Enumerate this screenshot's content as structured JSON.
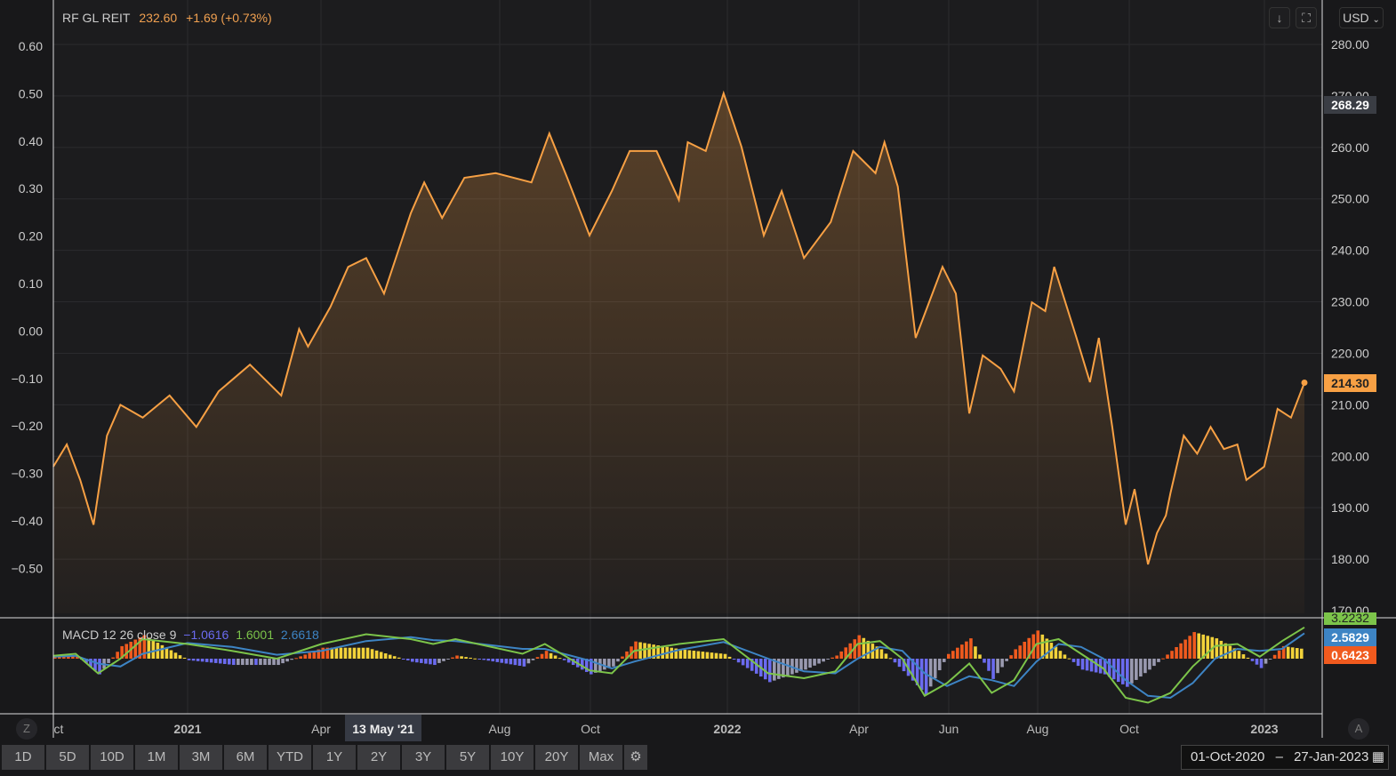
{
  "header": {
    "symbol": "RF GL REIT",
    "price": "232.60",
    "change": "+1.69 (+0.73%)",
    "currency": "USD"
  },
  "price_labels": {
    "high": "268.29",
    "last": "214.30"
  },
  "macd": {
    "label": "MACD 12 26 close 9",
    "hist": "−1.0616",
    "macd": "1.6001",
    "signal": "2.6618",
    "tag_macd": "3.2232",
    "tag_signal": "2.5829",
    "tag_hist": "0.6423"
  },
  "crosshair_date": "13 May '21",
  "toolbar": [
    "1D",
    "5D",
    "10D",
    "1M",
    "3M",
    "6M",
    "YTD",
    "1Y",
    "2Y",
    "3Y",
    "5Y",
    "10Y",
    "20Y",
    "Max"
  ],
  "date_range": {
    "from": "01-Oct-2020",
    "sep": "–",
    "to": "27-Jan-2023"
  },
  "buttons": {
    "zoom": "Z",
    "auto": "A"
  },
  "colors": {
    "price": "#f7a044",
    "macd": "#7cc44a",
    "signal": "#3d84c4",
    "hist_pos": "#f05a1e",
    "hist_pos2": "#f2d23a",
    "hist_neg": "#6b6bf0"
  },
  "chart_data": {
    "type": "line",
    "title": "RF GL REIT",
    "x_unit": "months since 01-Oct-2020",
    "xlim": [
      0,
      28
    ],
    "x_ticks": [
      {
        "t": 0,
        "label": "ct",
        "bold": false
      },
      {
        "t": 3,
        "label": "2021",
        "bold": true
      },
      {
        "t": 6,
        "label": "Apr",
        "bold": false
      },
      {
        "t": 10,
        "label": "Aug",
        "bold": false
      },
      {
        "t": 12,
        "label": "Oct",
        "bold": false
      },
      {
        "t": 15,
        "label": "2022",
        "bold": true
      },
      {
        "t": 18,
        "label": "Apr",
        "bold": false
      },
      {
        "t": 20,
        "label": "Jun",
        "bold": false
      },
      {
        "t": 22,
        "label": "Aug",
        "bold": false
      },
      {
        "t": 24,
        "label": "Oct",
        "bold": false
      },
      {
        "t": 27,
        "label": "2023",
        "bold": true
      }
    ],
    "right_axis": {
      "ylim": [
        170,
        280
      ],
      "ticks": [
        "280.00",
        "270.00",
        "260.00",
        "250.00",
        "240.00",
        "230.00",
        "220.00",
        "210.00",
        "200.00",
        "190.00",
        "180.00",
        "170.00"
      ]
    },
    "left_axis": {
      "ylim": [
        -0.5,
        0.6
      ],
      "ticks": [
        "0.60",
        "0.50",
        "0.40",
        "0.30",
        "0.20",
        "0.10",
        "0.00",
        "−0.10",
        "−0.20",
        "−0.30",
        "−0.40",
        "−0.50"
      ]
    },
    "price": [
      [
        0,
        198
      ],
      [
        0.3,
        202.3
      ],
      [
        0.6,
        195.4
      ],
      [
        0.9,
        186.7
      ],
      [
        1.2,
        204
      ],
      [
        1.5,
        210
      ],
      [
        2.0,
        207.5
      ],
      [
        2.6,
        211.8
      ],
      [
        3.2,
        205.7
      ],
      [
        3.7,
        212.6
      ],
      [
        4.4,
        217.8
      ],
      [
        5.1,
        211.8
      ],
      [
        5.5,
        224.7
      ],
      [
        5.7,
        221.3
      ],
      [
        6.2,
        229
      ],
      [
        6.6,
        236.8
      ],
      [
        7.0,
        238.5
      ],
      [
        7.4,
        231.6
      ],
      [
        8.0,
        247.2
      ],
      [
        8.3,
        253.2
      ],
      [
        8.7,
        246.3
      ],
      [
        9.2,
        254.1
      ],
      [
        9.9,
        255
      ],
      [
        10.7,
        253.2
      ],
      [
        11.1,
        262.7
      ],
      [
        11.5,
        254.1
      ],
      [
        12.0,
        242.9
      ],
      [
        12.5,
        251.5
      ],
      [
        12.9,
        259.3
      ],
      [
        13.5,
        259.3
      ],
      [
        14.0,
        249.8
      ],
      [
        14.2,
        261
      ],
      [
        14.6,
        259.3
      ],
      [
        15.0,
        270.5
      ],
      [
        15.4,
        260.1
      ],
      [
        15.9,
        242.9
      ],
      [
        16.3,
        251.5
      ],
      [
        16.8,
        238.5
      ],
      [
        17.4,
        245.5
      ],
      [
        17.9,
        259.3
      ],
      [
        18.4,
        255
      ],
      [
        18.6,
        261
      ],
      [
        18.9,
        252.4
      ],
      [
        19.3,
        223
      ],
      [
        19.6,
        229.9
      ],
      [
        19.9,
        236.8
      ],
      [
        20.2,
        231.6
      ],
      [
        20.5,
        208.3
      ],
      [
        20.8,
        219.6
      ],
      [
        21.2,
        217
      ],
      [
        21.5,
        212.6
      ],
      [
        21.9,
        229.9
      ],
      [
        22.2,
        228.2
      ],
      [
        22.4,
        236.8
      ],
      [
        22.9,
        223
      ],
      [
        23.2,
        214.4
      ],
      [
        23.4,
        223
      ],
      [
        23.7,
        205.7
      ],
      [
        24.0,
        186.7
      ],
      [
        24.2,
        193.6
      ],
      [
        24.5,
        179
      ],
      [
        24.7,
        185.1
      ],
      [
        24.9,
        188.5
      ],
      [
        25.0,
        192.8
      ],
      [
        25.3,
        204
      ],
      [
        25.6,
        200.5
      ],
      [
        25.9,
        205.7
      ],
      [
        26.2,
        201.4
      ],
      [
        26.5,
        202.3
      ],
      [
        26.7,
        195.4
      ],
      [
        27.1,
        198
      ],
      [
        27.4,
        209.2
      ],
      [
        27.7,
        207.5
      ],
      [
        28.0,
        214.3
      ]
    ],
    "macd_line": [
      [
        0,
        0.3
      ],
      [
        0.5,
        0.5
      ],
      [
        1,
        -1.5
      ],
      [
        1.5,
        0
      ],
      [
        2,
        2
      ],
      [
        3,
        1.5
      ],
      [
        4,
        0.8
      ],
      [
        5,
        0
      ],
      [
        6,
        1.5
      ],
      [
        7,
        2.5
      ],
      [
        8,
        2
      ],
      [
        8.5,
        1.5
      ],
      [
        9,
        2
      ],
      [
        10.5,
        0.5
      ],
      [
        11,
        1.5
      ],
      [
        12,
        -1.2
      ],
      [
        12.5,
        -1.5
      ],
      [
        13,
        0.8
      ],
      [
        14,
        1.5
      ],
      [
        15,
        2
      ],
      [
        16,
        -1.5
      ],
      [
        16.8,
        -2
      ],
      [
        17.5,
        -1.3
      ],
      [
        18,
        1.5
      ],
      [
        18.5,
        1.8
      ],
      [
        19,
        0
      ],
      [
        19.5,
        -3.8
      ],
      [
        20,
        -2.5
      ],
      [
        20.5,
        -0.5
      ],
      [
        21,
        -3.5
      ],
      [
        21.5,
        -2.2
      ],
      [
        22,
        1.5
      ],
      [
        22.5,
        2
      ],
      [
        23,
        0.5
      ],
      [
        23.5,
        -1
      ],
      [
        24,
        -4
      ],
      [
        24.5,
        -4.5
      ],
      [
        25,
        -3.5
      ],
      [
        25.5,
        -0.8
      ],
      [
        26,
        1.3
      ],
      [
        26.5,
        1.5
      ],
      [
        27,
        0.2
      ],
      [
        27.5,
        1.8
      ],
      [
        28,
        3.2
      ]
    ],
    "signal_line": [
      [
        0,
        0.2
      ],
      [
        0.5,
        0.3
      ],
      [
        1,
        -0.5
      ],
      [
        1.5,
        -0.8
      ],
      [
        2,
        0.5
      ],
      [
        3,
        1.6
      ],
      [
        4,
        1.2
      ],
      [
        5,
        0.4
      ],
      [
        6,
        0.8
      ],
      [
        7,
        1.8
      ],
      [
        8,
        2.2
      ],
      [
        8.5,
        1.9
      ],
      [
        9,
        1.8
      ],
      [
        10.5,
        1
      ],
      [
        11,
        1
      ],
      [
        12,
        -0.2
      ],
      [
        12.5,
        -1
      ],
      [
        13,
        -0.3
      ],
      [
        14,
        0.9
      ],
      [
        15,
        1.7
      ],
      [
        16,
        0
      ],
      [
        16.8,
        -1.3
      ],
      [
        17.5,
        -1.5
      ],
      [
        18,
        0
      ],
      [
        18.5,
        1.2
      ],
      [
        19,
        0.8
      ],
      [
        19.5,
        -1.5
      ],
      [
        20,
        -2.8
      ],
      [
        20.5,
        -1.8
      ],
      [
        21,
        -2.2
      ],
      [
        21.5,
        -2.8
      ],
      [
        22,
        -0.3
      ],
      [
        22.5,
        1.5
      ],
      [
        23,
        1.2
      ],
      [
        23.5,
        0
      ],
      [
        24,
        -2.2
      ],
      [
        24.5,
        -3.8
      ],
      [
        25,
        -4
      ],
      [
        25.5,
        -2.5
      ],
      [
        26,
        0
      ],
      [
        26.5,
        1
      ],
      [
        27,
        0.8
      ],
      [
        27.5,
        1
      ],
      [
        28,
        2.6
      ]
    ],
    "macd_ylim": [
      -5,
      4
    ]
  }
}
